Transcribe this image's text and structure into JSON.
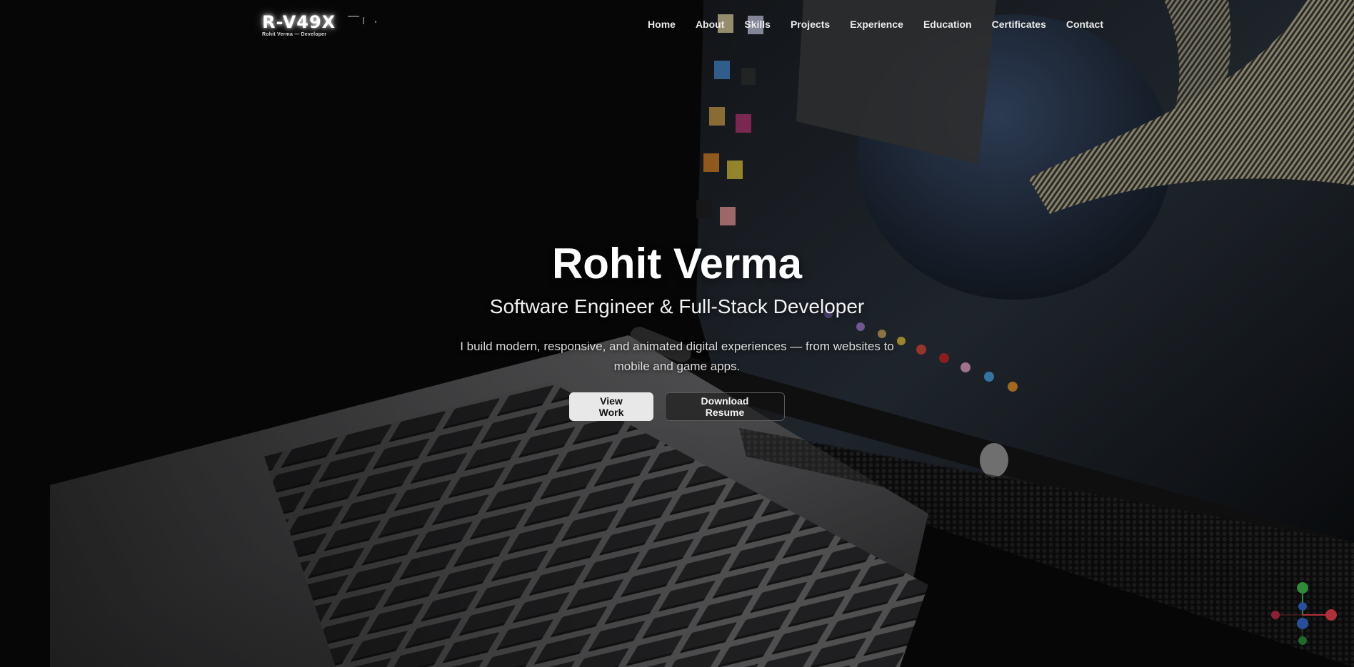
{
  "logo": {
    "mark": "R-V49X",
    "tagline": "Rohit Verma — Developer"
  },
  "nav": {
    "items": [
      {
        "label": "Home"
      },
      {
        "label": "About"
      },
      {
        "label": "Skills"
      },
      {
        "label": "Projects"
      },
      {
        "label": "Experience"
      },
      {
        "label": "Education"
      },
      {
        "label": "Certificates"
      },
      {
        "label": "Contact"
      }
    ]
  },
  "hero": {
    "title": "Rohit Verma",
    "subtitle": "Software Engineer & Full-Stack Developer",
    "description": "I build modern, responsive, and animated digital experiences — from websites to mobile and game apps.",
    "primary_cta": "View Work",
    "secondary_cta": "Download Resume"
  },
  "colors": {
    "background": "#090909",
    "text": "#ffffff",
    "primary_button": "#e8e8e8",
    "secondary_border": "#5a5a5a"
  },
  "icons": [
    "axis-gizmo-icon"
  ]
}
